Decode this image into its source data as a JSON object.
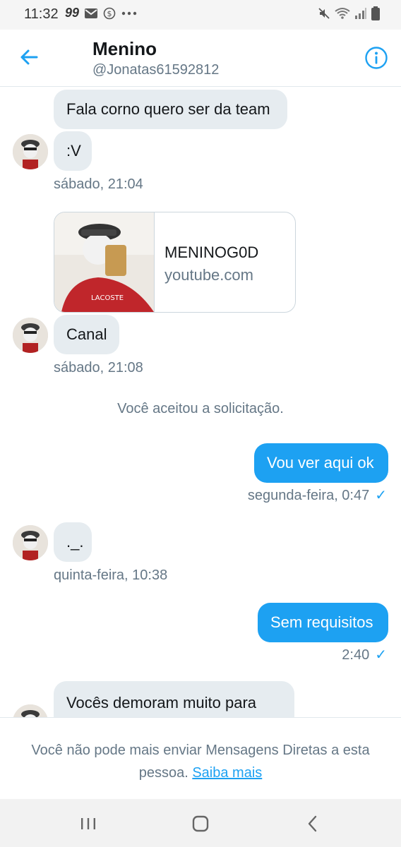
{
  "status_bar": {
    "time": "11:32",
    "badge": "99"
  },
  "header": {
    "name": "Menino",
    "handle": "@Jonatas61592812"
  },
  "messages": {
    "m1": "Fala corno quero ser da team",
    "m2": ":V",
    "t1": "sábado, 21:04",
    "card_title": "MENINOG0D",
    "card_domain": "youtube.com",
    "m3": "Canal",
    "t2": "sábado, 21:08",
    "system": "Você aceitou a solicitação.",
    "m4": "Vou ver aqui ok",
    "t3": "segunda-feira, 0:47",
    "m5": "._.",
    "t4": "quinta-feira, 10:38",
    "m6": "Sem requisitos",
    "t5": "2:40",
    "m7": "Vocês demoram muito para"
  },
  "footer": {
    "text": "Você não pode mais enviar Mensagens Diretas a esta pessoa.",
    "link": "Saiba mais"
  },
  "colors": {
    "accent": "#1da1f2",
    "bubble_in": "#e6ecf0",
    "muted": "#657786"
  }
}
